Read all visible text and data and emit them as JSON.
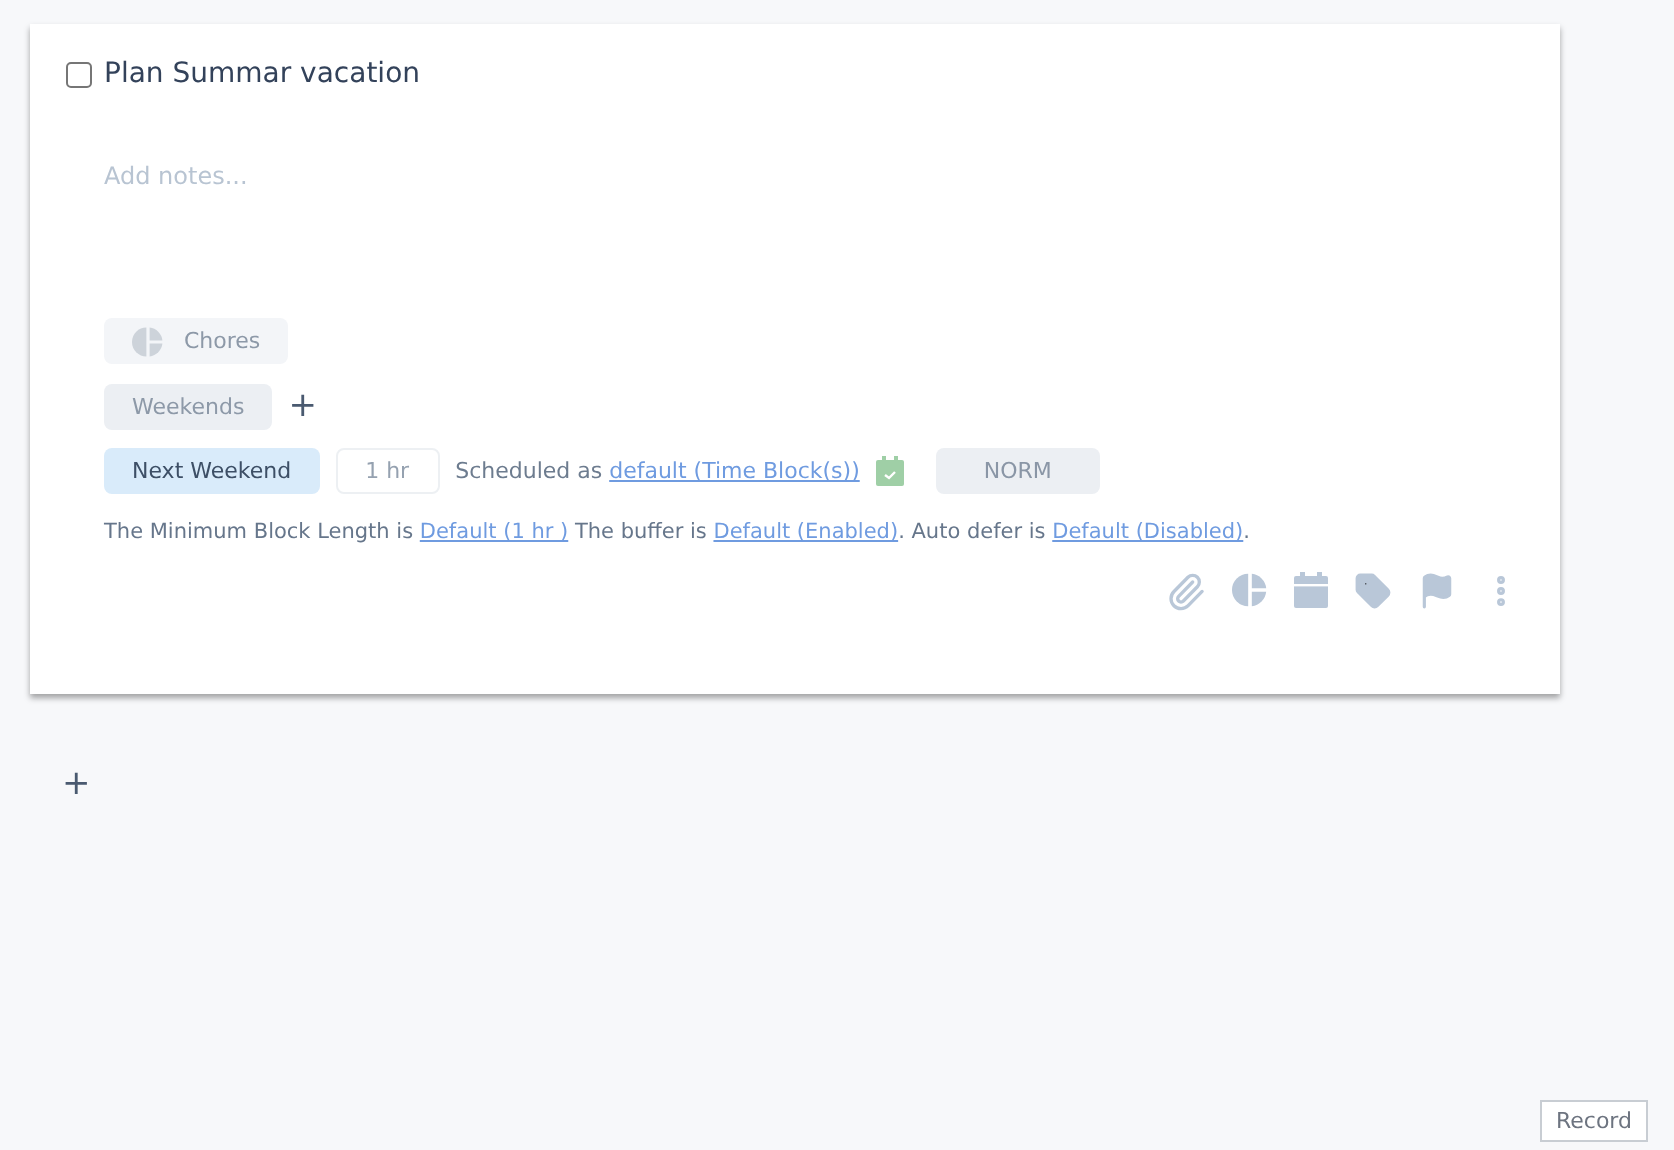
{
  "task": {
    "title": "Plan Summar vacation",
    "checked": false,
    "notes_placeholder": "Add notes...",
    "project": {
      "label": "Chores"
    },
    "tags": [
      {
        "label": "Weekends"
      }
    ],
    "add_tag": "+",
    "schedule": {
      "when": "Next Weekend",
      "duration_placeholder": "1 hr",
      "scheduled_prefix": "Scheduled as",
      "scheduled_link": "default (Time Block(s))",
      "priority": "NORM"
    },
    "settings": [
      {
        "kind": "text",
        "text": "The Minimum Block Length is"
      },
      {
        "kind": "link",
        "text": "Default (1 hr )"
      },
      {
        "kind": "text",
        "text": "The buffer is"
      },
      {
        "kind": "link",
        "text": "Default (Enabled)"
      },
      {
        "kind": "text",
        "text": ". Auto defer is"
      },
      {
        "kind": "link",
        "text": "Default (Disabled)"
      },
      {
        "kind": "text",
        "text": "."
      }
    ]
  },
  "add_task": "+",
  "record_button": "Record"
}
